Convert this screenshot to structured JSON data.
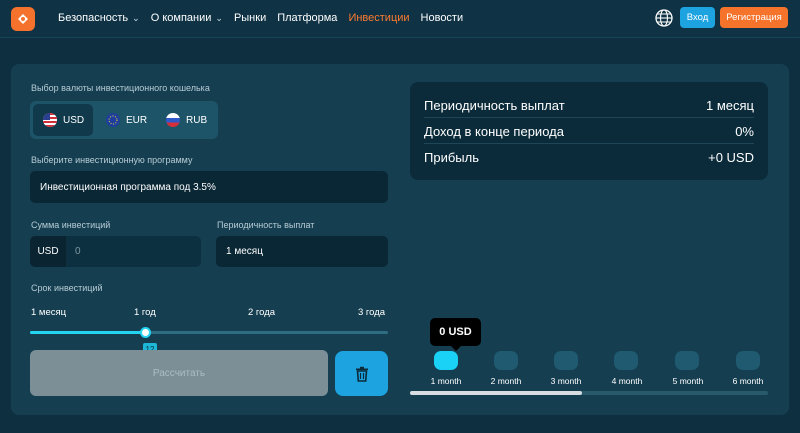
{
  "header": {
    "nav": [
      {
        "label": "Безопасность",
        "dropdown": true
      },
      {
        "label": "О компании",
        "dropdown": true
      },
      {
        "label": "Рынки",
        "dropdown": false
      },
      {
        "label": "Платформа",
        "dropdown": false
      },
      {
        "label": "Инвестиции",
        "dropdown": false,
        "active": true
      },
      {
        "label": "Новости",
        "dropdown": false
      }
    ],
    "login_label": "Вход",
    "register_label": "Регистрация",
    "language_icon": "globe-icon"
  },
  "form": {
    "currency_label": "Выбор валюты инвестиционного кошелька",
    "currencies": [
      {
        "code": "USD",
        "selected": true,
        "flag": "us-flag-icon"
      },
      {
        "code": "EUR",
        "selected": false,
        "flag": "eu-flag-icon"
      },
      {
        "code": "RUB",
        "selected": false,
        "flag": "ru-flag-icon"
      }
    ],
    "program_label": "Выберите инвестиционную программу",
    "program_value": "Инвестиционная программа под 3.5%",
    "amount_label": "Сумма инвестиций",
    "amount_prefix": "USD",
    "amount_placeholder": "0",
    "frequency_label": "Периодичность выплат",
    "frequency_value": "1 месяц",
    "term_label": "Срок инвестиций",
    "term_ticks": [
      "1 месяц",
      "1 год",
      "2 года",
      "3 года"
    ],
    "term_value": "12",
    "term_fraction": 0.32,
    "calculate_label": "Рассчитать",
    "delete_icon": "trash-icon"
  },
  "summary": {
    "rows": [
      {
        "label": "Периодичность выплат",
        "value": "1 месяц"
      },
      {
        "label": "Доход в конце периода",
        "value": "0%"
      },
      {
        "label": "Прибыль",
        "value": "+0 USD"
      }
    ]
  },
  "chart": {
    "tooltip": "0 USD",
    "months": [
      "1 month",
      "2 month",
      "3 month",
      "4 month",
      "5 month",
      "6 month"
    ],
    "scroll_fraction": 0.48
  },
  "colors": {
    "accent_orange": "#f5732a",
    "accent_blue": "#1da3e0",
    "accent_cyan": "#19d2f5",
    "panel": "#153f51"
  }
}
